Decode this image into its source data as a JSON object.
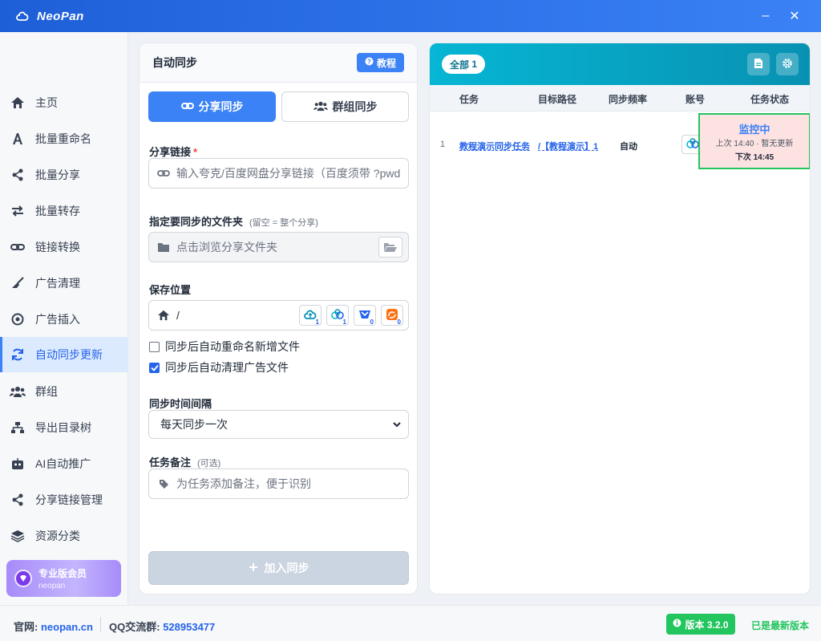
{
  "app": {
    "title": "NeoPan"
  },
  "window_controls": {
    "minimize": "–",
    "close": "✕"
  },
  "sidebar": {
    "items": [
      {
        "label": "主页",
        "icon": "home-icon"
      },
      {
        "label": "批量重命名",
        "icon": "font-icon"
      },
      {
        "label": "批量分享",
        "icon": "share-icon"
      },
      {
        "label": "批量转存",
        "icon": "exchange-icon"
      },
      {
        "label": "链接转换",
        "icon": "link-icon"
      },
      {
        "label": "广告清理",
        "icon": "broom-icon"
      },
      {
        "label": "广告插入",
        "icon": "target-icon"
      },
      {
        "label": "自动同步更新",
        "icon": "sync-icon",
        "active": true
      },
      {
        "label": "群组",
        "icon": "users-icon"
      },
      {
        "label": "导出目录树",
        "icon": "sitemap-icon"
      },
      {
        "label": "AI自动推广",
        "icon": "robot-icon"
      },
      {
        "label": "分享链接管理",
        "icon": "share-icon"
      },
      {
        "label": "资源分类",
        "icon": "layers-icon"
      }
    ],
    "pro": {
      "title": "专业版会员",
      "user": "neopan"
    }
  },
  "left_panel": {
    "title": "自动同步",
    "tutorial_label": "教程",
    "tabs": {
      "share": "分享同步",
      "group": "群组同步"
    },
    "share_link": {
      "label": "分享链接",
      "required": "*",
      "placeholder": "输入夸克/百度网盘分享链接（百度须带 ?pwd"
    },
    "folder": {
      "label": "指定要同步的文件夹",
      "hint": "(留空 = 整个分享)",
      "placeholder": "点击浏览分享文件夹"
    },
    "save_location": {
      "label": "保存位置",
      "path": "/",
      "clouds": [
        {
          "icon": "cloud-icon",
          "count": "1"
        },
        {
          "icon": "baidu-cloud-icon",
          "count": "1"
        },
        {
          "icon": "xunlei-icon",
          "count": "0"
        },
        {
          "icon": "uc-icon",
          "count": "0"
        }
      ]
    },
    "options": [
      {
        "label": "同步后自动重命名新增文件",
        "checked": false
      },
      {
        "label": "同步后自动清理广告文件",
        "checked": true
      }
    ],
    "interval": {
      "label": "同步时间间隔",
      "selected": "每天同步一次"
    },
    "note": {
      "label": "任务备注",
      "hint": "(可选)",
      "placeholder": "为任务添加备注，便于识别"
    },
    "submit_label": "加入同步"
  },
  "right_panel": {
    "filter_label": "全部",
    "filter_count": "1",
    "columns": {
      "task": "任务",
      "path": "目标路径",
      "freq": "同步频率",
      "account": "账号",
      "status": "任务状态"
    },
    "rows": [
      {
        "index": "1",
        "task": "教程演示同步任务",
        "path": "/【教程演示】1",
        "freq": "自动",
        "status_title": "监控中",
        "status_last": "上次 14:40 · 暂无更新",
        "status_next": "下次 14:45"
      }
    ]
  },
  "footer": {
    "site_label": "官网:",
    "site_value": "neopan.cn",
    "qq_label": "QQ交流群:",
    "qq_value": "528953477",
    "version_label": "版本 3.2.0",
    "version_status": "已是最新版本"
  },
  "colors": {
    "accent": "#3b82f6",
    "success": "#22c55e",
    "header_teal": "#06b6d4"
  }
}
